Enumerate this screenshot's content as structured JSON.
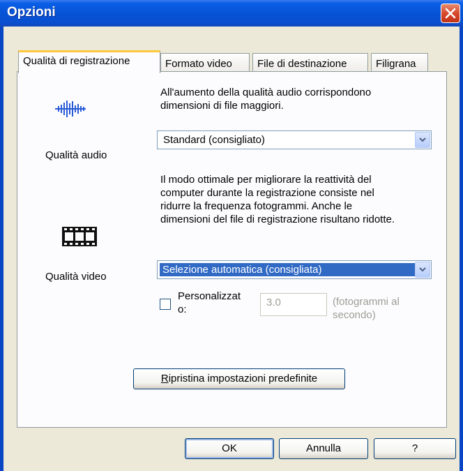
{
  "window": {
    "title": "Opzioni"
  },
  "tabs": [
    {
      "label": "Qualità di registrazione"
    },
    {
      "label": "Formato video"
    },
    {
      "label": "File di destinazione"
    },
    {
      "label": "Filigrana"
    }
  ],
  "audio": {
    "label": "Qualità audio",
    "description_lines": [
      "All'aumento della qualità audio corrispondono",
      "dimensioni di file maggiori."
    ],
    "selected": "Standard (consigliato)",
    "icon": "audio-waveform-icon"
  },
  "video": {
    "label": "Qualità video",
    "description_lines": [
      "Il modo ottimale per migliorare la reattività del",
      "computer durante la registrazione consiste nel",
      "ridurre la frequenza fotogrammi. Anche le",
      "dimensioni del file di registrazione risultano ridotte."
    ],
    "selected": "Selezione automatica (consigliata)",
    "icon": "film-strip-icon",
    "custom_label_lines": [
      "Personalizzat",
      "o:"
    ],
    "custom_checked": false,
    "fps_value": "3.0",
    "fps_unit_lines": [
      "(fotogrammi al",
      "secondo)"
    ]
  },
  "reset_button": {
    "accel": "R",
    "rest": "ipristina impostazioni predefinite"
  },
  "buttons": {
    "ok": "OK",
    "cancel": "Annulla",
    "help": "?"
  },
  "colors": {
    "titlebar": "#0653d6",
    "selection": "#316ac5",
    "tab_highlight": "#ffc83c"
  }
}
